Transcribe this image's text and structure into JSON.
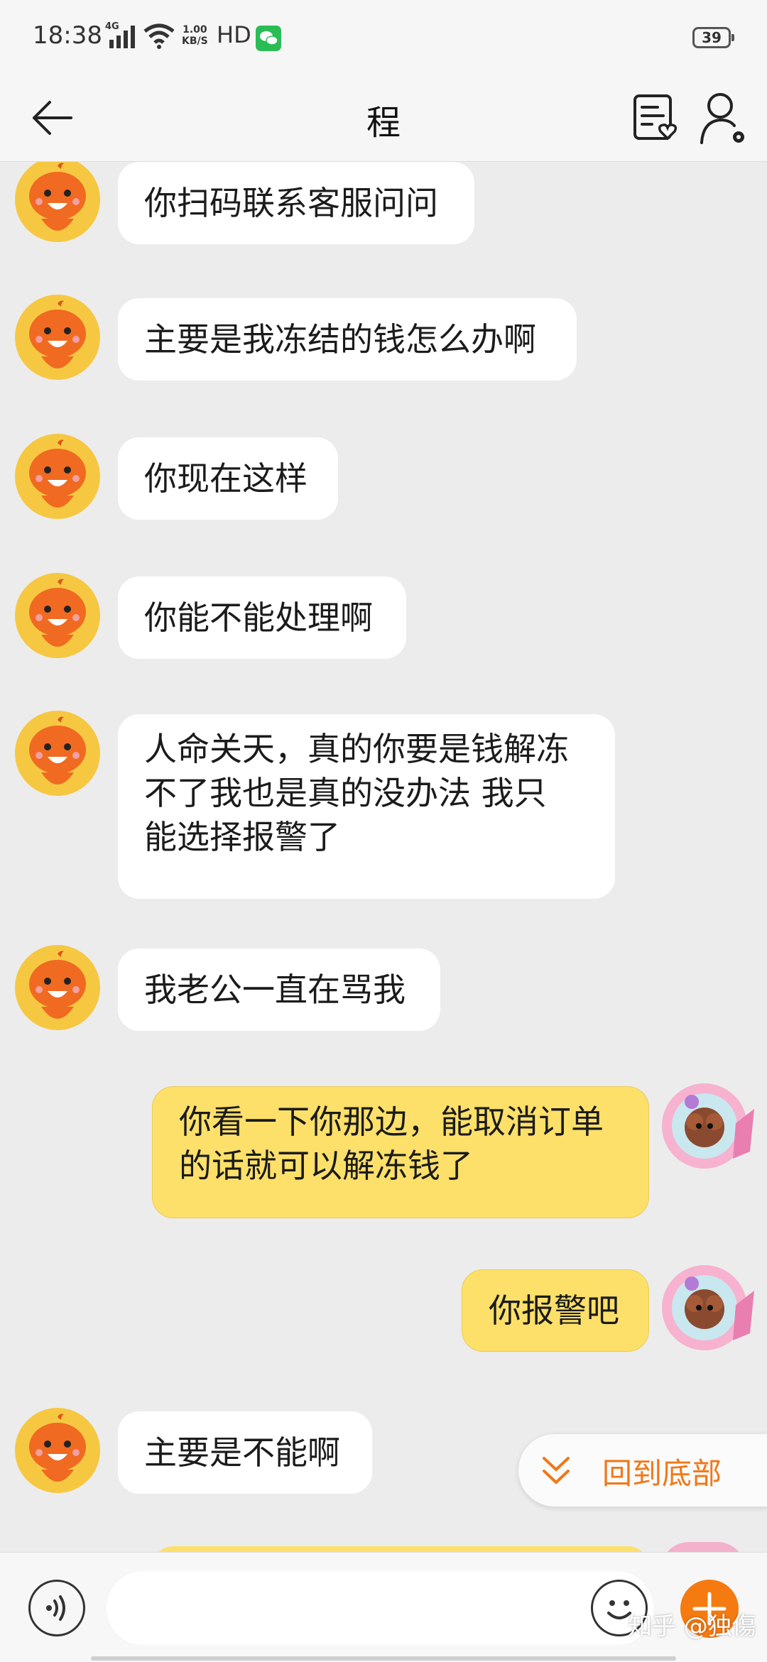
{
  "status_bar": {
    "time": "18:38",
    "network": "4G",
    "speed_value": "1.00",
    "speed_unit": "KB/S",
    "hd": "HD",
    "battery": "39"
  },
  "header": {
    "title": "程"
  },
  "messages": [
    {
      "side": "left",
      "text": "你扫码联系客服问问"
    },
    {
      "side": "left",
      "text": "主要是我冻结的钱怎么办啊"
    },
    {
      "side": "left",
      "text": "你现在这样"
    },
    {
      "side": "left",
      "text": "你能不能处理啊"
    },
    {
      "side": "left",
      "lines": [
        "人命关天，真的你要是钱解冻",
        "不了我也是真的没办法 我只",
        "能选择报警了"
      ]
    },
    {
      "side": "left",
      "text": "我老公一直在骂我"
    },
    {
      "side": "right",
      "lines": [
        "你看一下你那边，能取消订单",
        "的话就可以解冻钱了"
      ]
    },
    {
      "side": "right",
      "text": "你报警吧"
    },
    {
      "side": "left",
      "text": "主要是不能啊"
    }
  ],
  "back_to_bottom": {
    "label": "回到底部"
  },
  "input": {
    "value": "",
    "placeholder": ""
  },
  "watermark": "知乎 @独傷",
  "colors": {
    "accent": "#f57a10",
    "self_bubble": "#fde06a",
    "other_bubble": "#ffffff",
    "background": "#ececec"
  },
  "icons": {
    "back": "arrow-left-icon",
    "order": "order-list-heart-icon",
    "profile": "user-settings-icon",
    "voice": "voice-icon",
    "emoji": "emoji-icon",
    "plus": "plus-icon",
    "back_to_bottom": "double-chevron-down-icon"
  }
}
